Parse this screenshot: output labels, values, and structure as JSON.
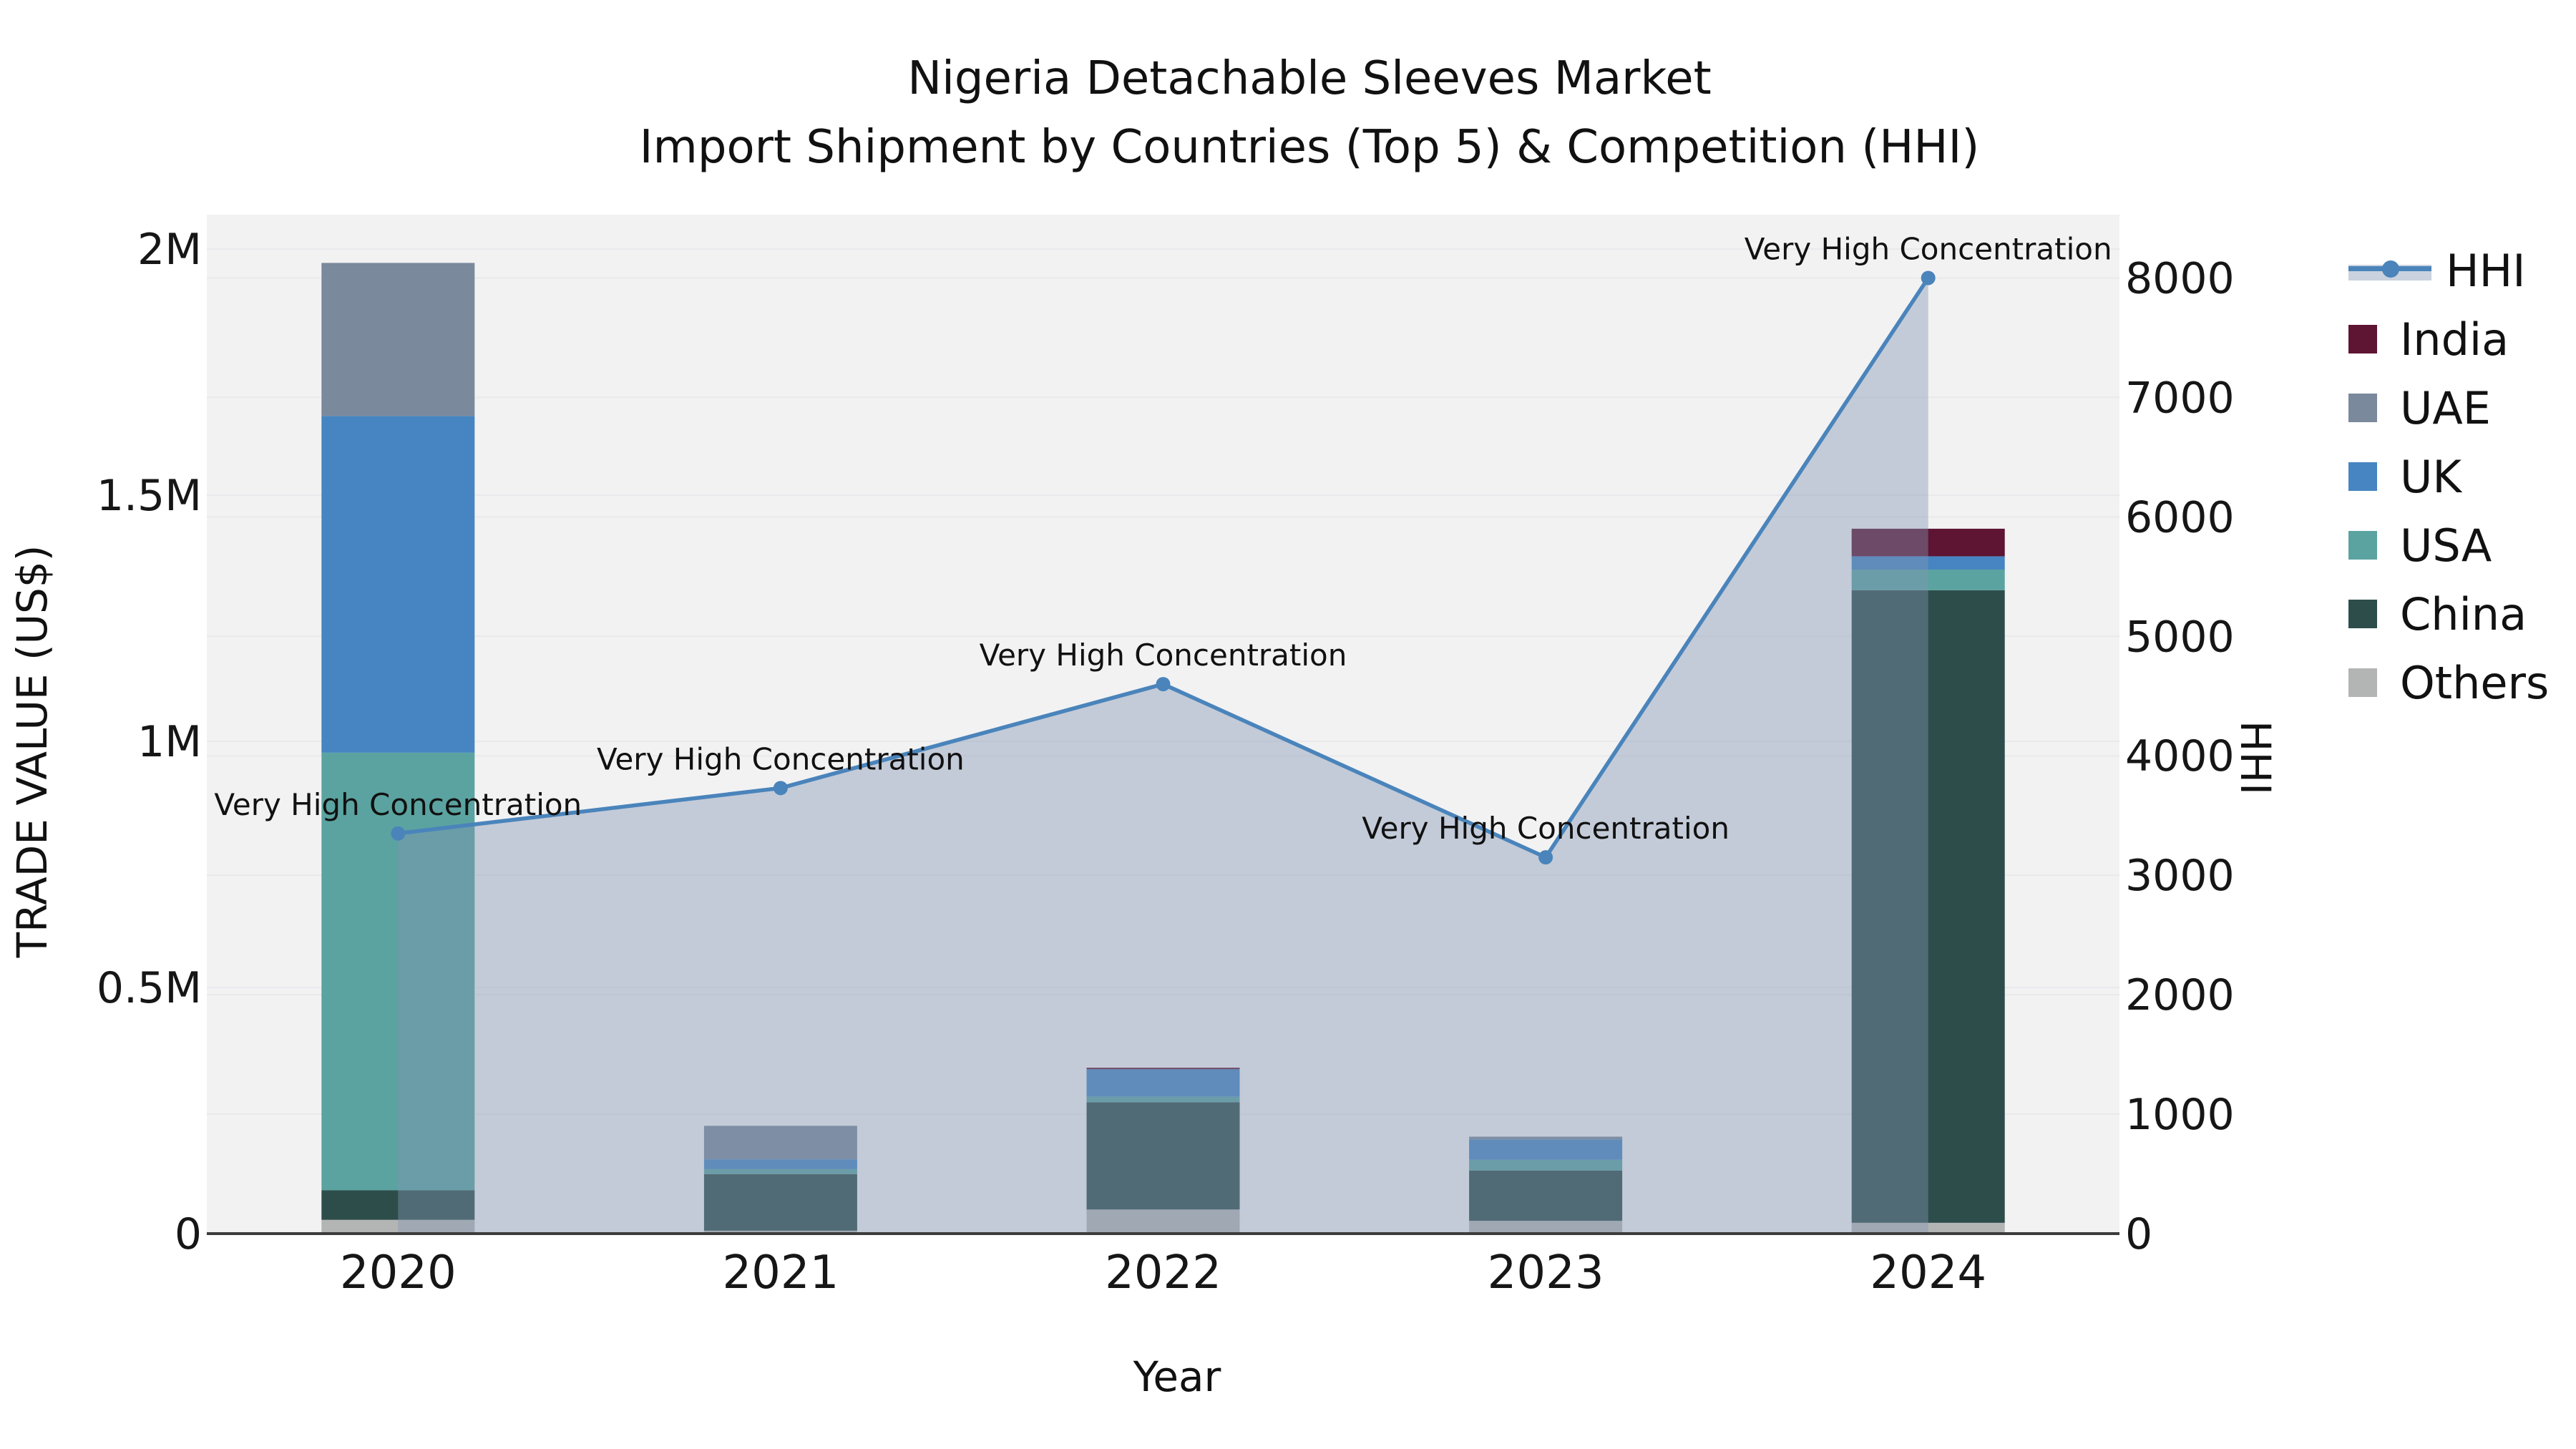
{
  "title": {
    "line1": "Nigeria Detachable Sleeves Market",
    "line2": "Import Shipment by Countries (Top 5) & Competition (HHI)"
  },
  "axes": {
    "y_left": {
      "label": "TRADE VALUE (US$)",
      "tick_labels": [
        "0",
        "0.5M",
        "1M",
        "1.5M",
        "2M"
      ],
      "tick_values": [
        0,
        500000,
        1000000,
        1500000,
        2000000
      ],
      "max_value": 2070000
    },
    "y_right": {
      "label": "HHI",
      "tick_labels": [
        "0",
        "1000",
        "2000",
        "3000",
        "4000",
        "5000",
        "6000",
        "7000",
        "8000"
      ],
      "tick_values": [
        0,
        1000,
        2000,
        3000,
        4000,
        5000,
        6000,
        7000,
        8000
      ],
      "max_value": 8530
    },
    "x": {
      "label": "Year",
      "categories": [
        "2020",
        "2021",
        "2022",
        "2023",
        "2024"
      ]
    }
  },
  "legend": {
    "items": [
      {
        "label": "HHI",
        "type": "line",
        "color": "#4a84bb",
        "band_color": "#c9d2de"
      },
      {
        "label": "India",
        "type": "square",
        "color": "#5e1433"
      },
      {
        "label": "UAE",
        "type": "square",
        "color": "#7b899c"
      },
      {
        "label": "UK",
        "type": "square",
        "color": "#4685c1"
      },
      {
        "label": "USA",
        "type": "square",
        "color": "#5ba3a0"
      },
      {
        "label": "China",
        "type": "square",
        "color": "#2d4d4b"
      },
      {
        "label": "Others",
        "type": "square",
        "color": "#b3b5b4"
      }
    ]
  },
  "chart_data": {
    "type": "bar+line",
    "categories": [
      "2020",
      "2021",
      "2022",
      "2023",
      "2024"
    ],
    "bar_unit": "US$",
    "series": [
      {
        "name": "Others",
        "color": "#b3b5b4",
        "values": [
          28000,
          6000,
          49000,
          26000,
          22000
        ]
      },
      {
        "name": "China",
        "color": "#2d4d4b",
        "values": [
          60000,
          115000,
          218000,
          102000,
          1285000
        ]
      },
      {
        "name": "USA",
        "color": "#5ba3a0",
        "values": [
          889000,
          10000,
          11000,
          22000,
          42000
        ]
      },
      {
        "name": "UK",
        "color": "#4685c1",
        "values": [
          684000,
          20000,
          56000,
          41000,
          27000
        ]
      },
      {
        "name": "UAE",
        "color": "#7b899c",
        "values": [
          311000,
          68000,
          0,
          6000,
          0
        ]
      },
      {
        "name": "India",
        "color": "#5e1433",
        "values": [
          0,
          0,
          3000,
          0,
          56000
        ]
      }
    ],
    "hhi": {
      "name": "HHI",
      "axis": "right",
      "line_color": "#4a84bb",
      "fill_color_rgba": "rgba(130,150,178,0.42)",
      "values": [
        3350,
        3730,
        4600,
        3150,
        8000
      ],
      "annotations": [
        "Very High Concentration",
        "Very High Concentration",
        "Very High Concentration",
        "Very High Concentration",
        "Very High Concentration"
      ]
    },
    "ylabel": "TRADE VALUE (US$)",
    "ylabel_right": "HHI",
    "xlabel": "Year",
    "ylim_left": [
      0,
      2070000
    ],
    "ylim_right": [
      0,
      8530
    ],
    "grid": true,
    "legend_position": "right-outside",
    "plot_background": "#f2f2f3",
    "gridline_color": "#e9e9ec",
    "axis_line_color": "#3c3c3c",
    "tick_color": "#161616",
    "annotation_color": "#111111"
  }
}
